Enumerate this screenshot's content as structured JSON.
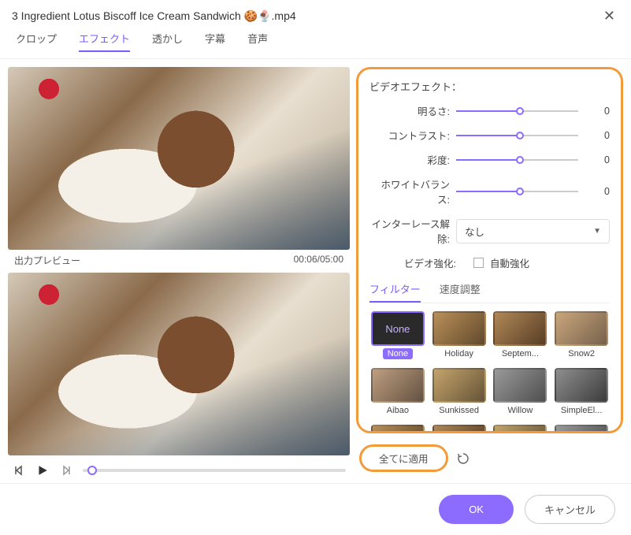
{
  "window": {
    "title": "3 Ingredient Lotus Biscoff Ice Cream Sandwich 🍪🍨.mp4"
  },
  "tabs": {
    "crop": "クロップ",
    "effect": "エフェクト",
    "watermark": "透かし",
    "subtitle": "字幕",
    "audio": "音声"
  },
  "preview": {
    "label": "出力プレビュー",
    "time": "00:06/05:00"
  },
  "effects": {
    "heading": "ビデオエフェクト：",
    "brightness": {
      "label": "明るさ:",
      "value": "0"
    },
    "contrast": {
      "label": "コントラスト:",
      "value": "0"
    },
    "saturation": {
      "label": "彩度:",
      "value": "0"
    },
    "whitebalance": {
      "label": "ホワイトバランス:",
      "value": "0"
    },
    "deinterlace": {
      "label": "インターレース解除:",
      "value": "なし"
    },
    "enhance": {
      "label": "ビデオ強化:",
      "checkbox": "自動強化"
    }
  },
  "subtabs": {
    "filter": "フィルター",
    "speed": "速度調整"
  },
  "filters": {
    "none_thumb": "None",
    "none": "None",
    "holiday": "Holiday",
    "september": "Septem...",
    "snow2": "Snow2",
    "aibao": "Aibao",
    "sunkissed": "Sunkissed",
    "willow": "Willow",
    "simpleel": "SimpleEl..."
  },
  "buttons": {
    "apply_all": "全てに適用",
    "ok": "OK",
    "cancel": "キャンセル"
  }
}
